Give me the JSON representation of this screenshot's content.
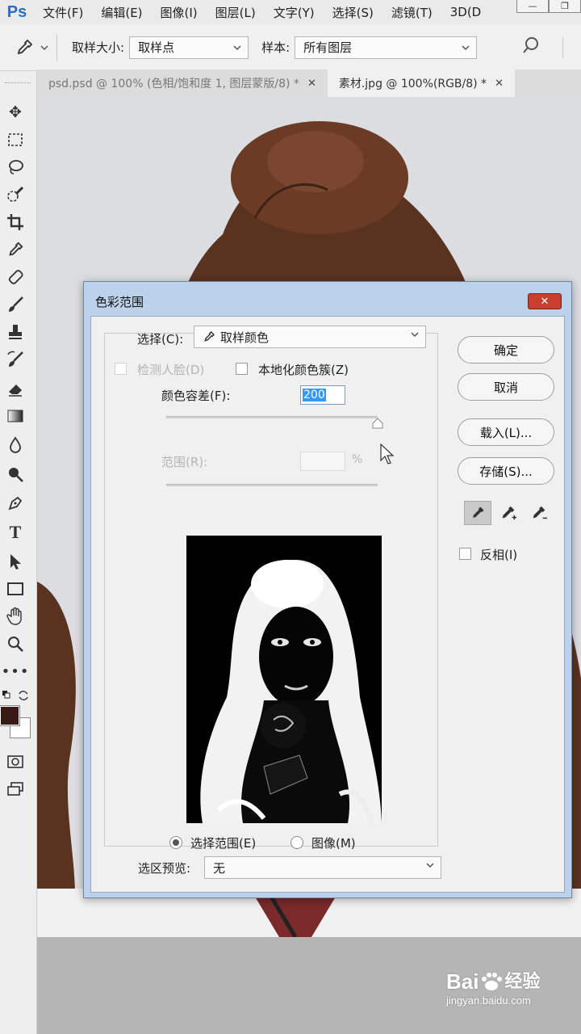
{
  "app": {
    "logo": "Ps",
    "menu": [
      "文件(F)",
      "编辑(E)",
      "图像(I)",
      "图层(L)",
      "文字(Y)",
      "选择(S)",
      "滤镜(T)",
      "3D(D"
    ],
    "window_controls": [
      "—",
      "❐"
    ]
  },
  "options_bar": {
    "tool_icon": "eyedropper-icon",
    "sample_size_label": "取样大小:",
    "sample_size_value": "取样点",
    "sample_label": "样本:",
    "sample_value": "所有图层"
  },
  "tabs": [
    {
      "title": "psd.psd @ 100% (色相/饱和度 1, 图层蒙版/8) *",
      "active": false,
      "close": "✕"
    },
    {
      "title": "素材.jpg @ 100%(RGB/8) *",
      "active": true,
      "close": "✕"
    }
  ],
  "toolbar": {
    "tools": [
      "move-icon",
      "marquee-icon",
      "lasso-icon",
      "quick-select-icon",
      "crop-icon",
      "eyedropper-icon",
      "healing-brush-icon",
      "brush-icon",
      "clone-stamp-icon",
      "history-brush-icon",
      "eraser-icon",
      "gradient-icon",
      "blur-icon",
      "dodge-icon",
      "pen-icon",
      "type-icon",
      "path-select-icon",
      "rectangle-icon",
      "hand-icon",
      "zoom-icon",
      "more-icon"
    ],
    "foreground_color": "#3a1a14",
    "background_color": "#ffffff"
  },
  "dialog": {
    "title": "色彩范围",
    "close_glyph": "✕",
    "select_label": "选择(C):",
    "select_value": "取样颜色",
    "detect_faces_label": "检测人脸(D)",
    "localized_label": "本地化颜色簇(Z)",
    "fuzziness_label": "颜色容差(F):",
    "fuzziness_value": "200",
    "fuzziness_fraction": 1.0,
    "range_label": "范围(R):",
    "range_unit": "%",
    "radio_selection_label": "选择范围(E)",
    "radio_image_label": "图像(M)",
    "radio_selected": "selection",
    "preview_label": "选区预览:",
    "preview_value": "无",
    "buttons": {
      "ok": "确定",
      "cancel": "取消",
      "load": "载入(L)...",
      "save": "存储(S)..."
    },
    "invert_label": "反相(I)",
    "invert_checked": false
  },
  "watermark": {
    "brand": "Bai",
    "brand_cn": "经验",
    "url": "jingyan.baidu.com"
  },
  "colors": {
    "accent": "#2c6fb8",
    "dialog_frame": "#bcd1ea",
    "hair": "#5a3220",
    "close_button": "#c8402d"
  }
}
